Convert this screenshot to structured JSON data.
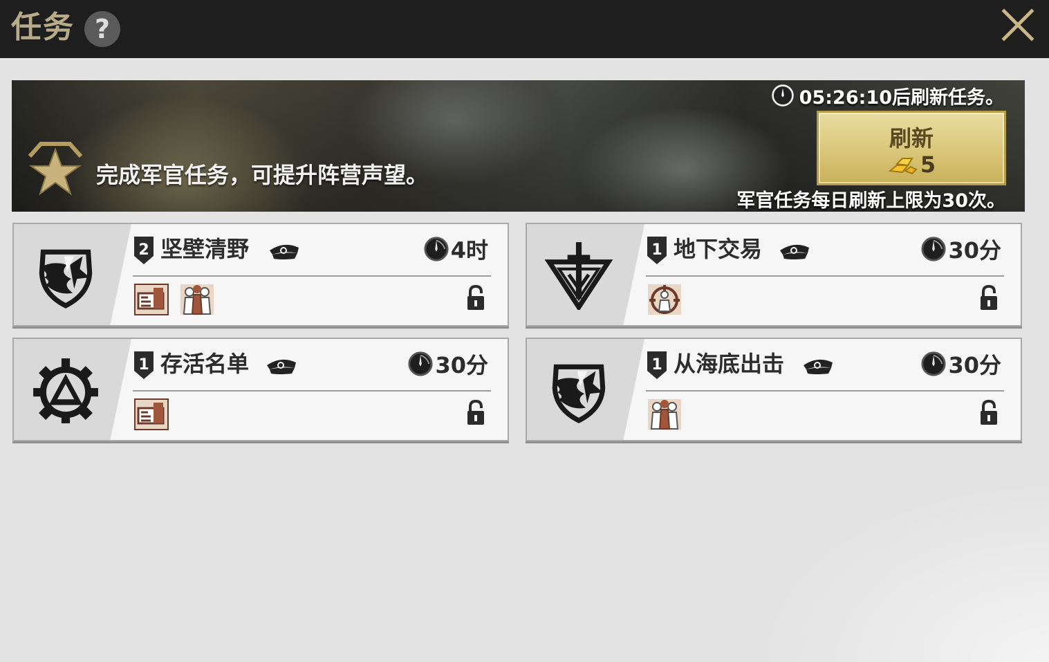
{
  "header": {
    "title": "任务",
    "help_label": "?",
    "close_icon": "close-x-icon"
  },
  "banner": {
    "description": "完成军官任务，可提升阵营声望。",
    "timer_text": "05:26:10后刷新任务。",
    "refresh_label": "刷新",
    "refresh_cost": "5",
    "daily_limit_text": "军官任务每日刷新上限为30次。"
  },
  "missions": [
    {
      "name": "坚壁清野",
      "level": "2",
      "duration": "4时",
      "faction_icon": "eagle-emblem-icon",
      "requirements": [
        "factory-icon",
        "officers-icon"
      ]
    },
    {
      "name": "地下交易",
      "level": "1",
      "duration": "30分",
      "faction_icon": "sword-triangle-emblem-icon",
      "requirements": [
        "spy-icon"
      ]
    },
    {
      "name": "存活名单",
      "level": "1",
      "duration": "30分",
      "faction_icon": "gear-emblem-icon",
      "requirements": [
        "factory-icon"
      ]
    },
    {
      "name": "从海底出击",
      "level": "1",
      "duration": "30分",
      "faction_icon": "eagle-emblem-icon",
      "requirements": [
        "officers-icon"
      ]
    }
  ],
  "colors": {
    "topbar": "#1e1e1e",
    "title": "#b8ab8a",
    "refresh_button": "#d9c679",
    "card_bg": "#f6f6f6"
  }
}
